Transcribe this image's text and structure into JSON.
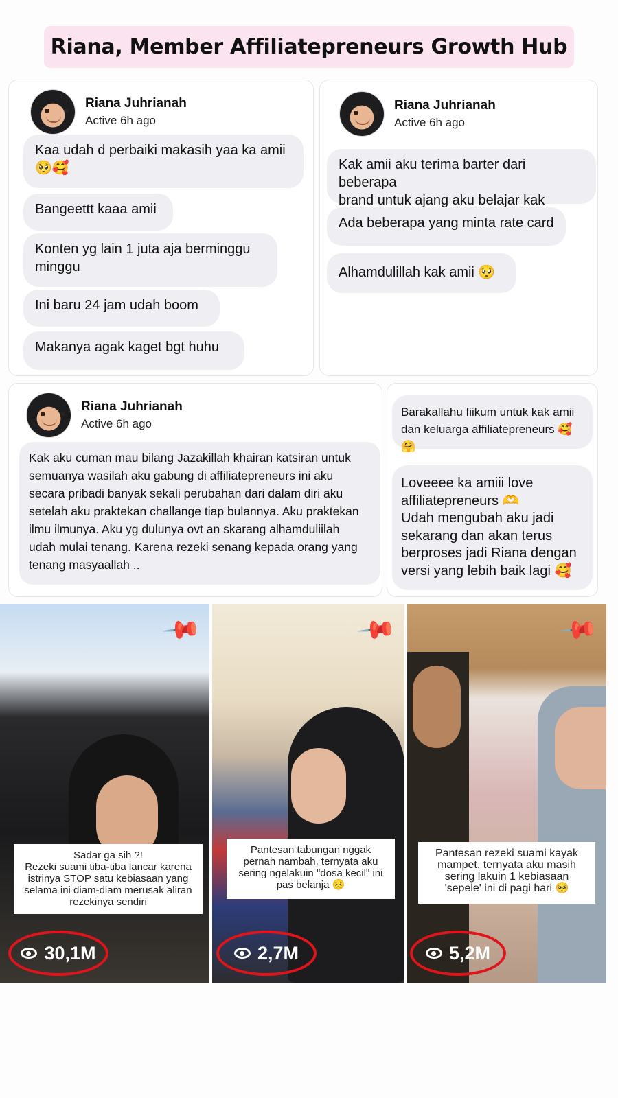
{
  "banner": {
    "title": "Riana, Member Affiliatepreneurs Growth Hub"
  },
  "chats": {
    "name": "Riana Juhrianah",
    "status": "Active 6h ago",
    "card1": [
      "Kaa udah d perbaiki makasih yaa ka amii\n🥺🥰",
      "Bangeettt kaaa amii",
      "Konten yg lain 1 juta aja berminggu\nminggu",
      "Ini baru 24 jam udah boom",
      "Makanya agak kaget bgt huhu"
    ],
    "card2": [
      "Kak amii aku terima barter dari beberapa\nbrand untuk ajang aku belajar kak",
      "Ada beberapa yang minta rate card",
      "Alhamdulillah kak amii 🥺"
    ],
    "card3": "Kak aku cuman mau bilang Jazakillah khairan katsiran untuk\nsemuanya wasilah aku gabung di affiliatepreneurs ini aku\nsecara pribadi banyak sekali perubahan dari dalam diri aku\nsetelah aku praktekan challange tiap bulannya. Aku praktekan\nilmu ilmunya. Aku yg dulunya ovt an skarang alhamduliilah\nudah mulai tenang. Karena rezeki senang kepada orang yang\ntenang masyaallah ..",
    "card4": [
      "Barakallahu fiikum untuk kak amii\ndan keluarga affiliatepreneurs 🥰🤗",
      "Loveeee ka amiii love\naffiliatepreneurs 🫶\nUdah mengubah aku jadi\nsekarang dan akan terus\nberproses jadi Riana dengan\nversi yang lebih baik lagi 🥰"
    ]
  },
  "videos": [
    {
      "caption": "Sadar ga sih ?!\nRezeki suami tiba-tiba lancar karena\nistrinya STOP satu kebiasaan yang\nselama ini diam-diam merusak aliran\nrezekinya sendiri",
      "views": "30,1M"
    },
    {
      "caption": "Pantesan tabungan nggak\npernah nambah, ternyata aku\nsering ngelakuin \"dosa kecil\" ini\npas belanja 😣",
      "views": "2,7M"
    },
    {
      "caption": "Pantesan rezeki suami kayak\nmampet, ternyata aku masih\nsering lakuin 1 kebiasaan\n'sepele' ini di pagi hari 🥺",
      "views": "5,2M"
    }
  ],
  "icons": {
    "pin": "pin-icon",
    "views": "eye-icon",
    "avatar": "avatar"
  },
  "colors": {
    "banner": "#fbe3f0",
    "bubble": "#efeff3",
    "views_ring": "#e0141b"
  }
}
